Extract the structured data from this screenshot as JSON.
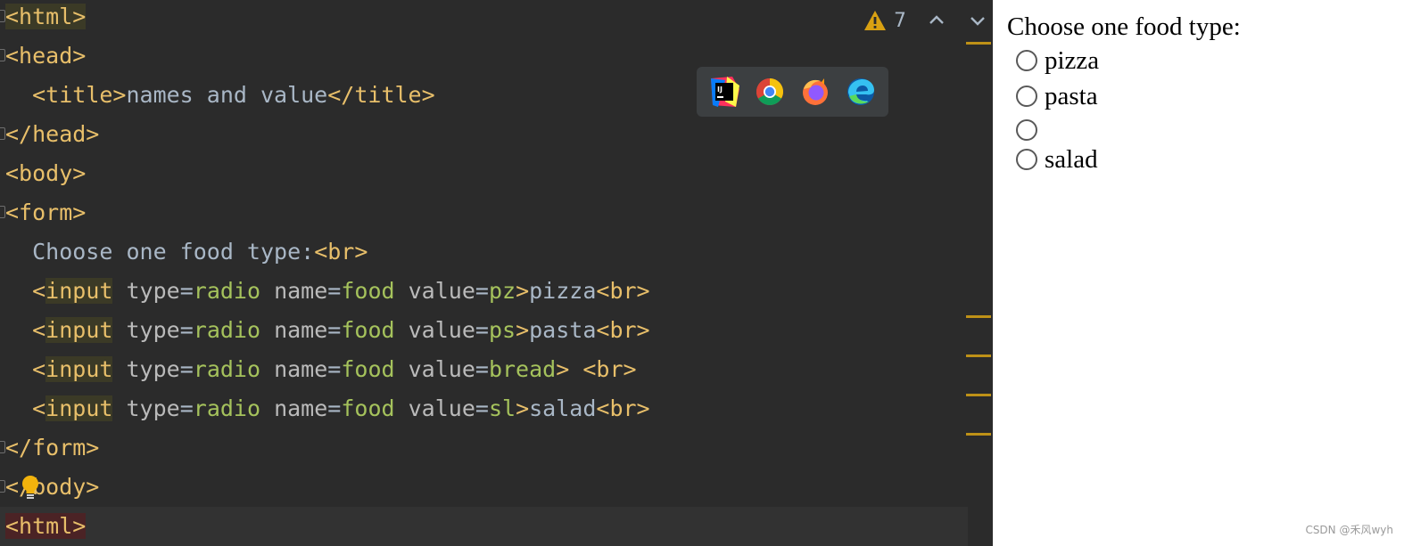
{
  "editor": {
    "lines": [
      {
        "parts": [
          {
            "c": "tag hl-olive",
            "t": "<html>"
          }
        ]
      },
      {
        "parts": [
          {
            "c": "tag",
            "t": "<head>"
          }
        ]
      },
      {
        "parts": [
          {
            "c": "txt",
            "t": "  "
          },
          {
            "c": "tag",
            "t": "<title>"
          },
          {
            "c": "txt",
            "t": "names and value"
          },
          {
            "c": "tag",
            "t": "</title>"
          }
        ]
      },
      {
        "parts": [
          {
            "c": "tag",
            "t": "</head>"
          }
        ]
      },
      {
        "parts": [
          {
            "c": "tag",
            "t": "<body>"
          }
        ]
      },
      {
        "parts": [
          {
            "c": "tag",
            "t": "<form>"
          }
        ]
      },
      {
        "parts": [
          {
            "c": "txt",
            "t": "  Choose one food type:"
          },
          {
            "c": "tag",
            "t": "<br>"
          }
        ]
      },
      {
        "parts": [
          {
            "c": "txt",
            "t": "  "
          },
          {
            "c": "tag",
            "t": "<"
          },
          {
            "c": "tag hl-olive",
            "t": "input"
          },
          {
            "c": "attr",
            "t": " type"
          },
          {
            "c": "txt",
            "t": "="
          },
          {
            "c": "val",
            "t": "radio"
          },
          {
            "c": "attr",
            "t": " name"
          },
          {
            "c": "txt",
            "t": "="
          },
          {
            "c": "val",
            "t": "food"
          },
          {
            "c": "attr",
            "t": " value"
          },
          {
            "c": "txt",
            "t": "="
          },
          {
            "c": "val",
            "t": "pz"
          },
          {
            "c": "tag",
            "t": ">"
          },
          {
            "c": "txt",
            "t": "pizza"
          },
          {
            "c": "tag",
            "t": "<br>"
          }
        ]
      },
      {
        "parts": [
          {
            "c": "txt",
            "t": "  "
          },
          {
            "c": "tag",
            "t": "<"
          },
          {
            "c": "tag hl-olive",
            "t": "input"
          },
          {
            "c": "attr",
            "t": " type"
          },
          {
            "c": "txt",
            "t": "="
          },
          {
            "c": "val",
            "t": "radio"
          },
          {
            "c": "attr",
            "t": " name"
          },
          {
            "c": "txt",
            "t": "="
          },
          {
            "c": "val",
            "t": "food"
          },
          {
            "c": "attr",
            "t": " value"
          },
          {
            "c": "txt",
            "t": "="
          },
          {
            "c": "val",
            "t": "ps"
          },
          {
            "c": "tag",
            "t": ">"
          },
          {
            "c": "txt",
            "t": "pasta"
          },
          {
            "c": "tag",
            "t": "<br>"
          }
        ]
      },
      {
        "parts": [
          {
            "c": "txt",
            "t": "  "
          },
          {
            "c": "tag",
            "t": "<"
          },
          {
            "c": "tag hl-olive",
            "t": "input"
          },
          {
            "c": "attr",
            "t": " type"
          },
          {
            "c": "txt",
            "t": "="
          },
          {
            "c": "val",
            "t": "radio"
          },
          {
            "c": "attr",
            "t": " name"
          },
          {
            "c": "txt",
            "t": "="
          },
          {
            "c": "val",
            "t": "food"
          },
          {
            "c": "attr",
            "t": " value"
          },
          {
            "c": "txt",
            "t": "="
          },
          {
            "c": "val",
            "t": "bread"
          },
          {
            "c": "tag",
            "t": ">"
          },
          {
            "c": "txt",
            "t": " "
          },
          {
            "c": "tag",
            "t": "<br>"
          }
        ]
      },
      {
        "parts": [
          {
            "c": "txt",
            "t": "  "
          },
          {
            "c": "tag",
            "t": "<"
          },
          {
            "c": "tag hl-olive",
            "t": "input"
          },
          {
            "c": "attr",
            "t": " type"
          },
          {
            "c": "txt",
            "t": "="
          },
          {
            "c": "val",
            "t": "radio"
          },
          {
            "c": "attr",
            "t": " name"
          },
          {
            "c": "txt",
            "t": "="
          },
          {
            "c": "val",
            "t": "food"
          },
          {
            "c": "attr",
            "t": " value"
          },
          {
            "c": "txt",
            "t": "="
          },
          {
            "c": "val",
            "t": "sl"
          },
          {
            "c": "tag",
            "t": ">"
          },
          {
            "c": "txt",
            "t": "salad"
          },
          {
            "c": "tag",
            "t": "<br>"
          }
        ]
      },
      {
        "parts": [
          {
            "c": "tag",
            "t": "</form>"
          }
        ]
      },
      {
        "parts": [
          {
            "c": "tag",
            "t": "</body>"
          }
        ]
      },
      {
        "parts": [
          {
            "c": "tag hl-red",
            "t": "<html>"
          }
        ],
        "current": true
      }
    ],
    "folded_lines": [
      0,
      1,
      3,
      5,
      11,
      12
    ],
    "warning_count": "7",
    "icons": {
      "warning": "warning-triangle-icon",
      "previous": "chevron-up-icon",
      "next": "chevron-down-icon",
      "intention": "lightbulb-icon"
    },
    "browsers": [
      "intellij-idea-icon",
      "chrome-icon",
      "firefox-icon",
      "edge-icon"
    ],
    "colors": {
      "background": "#2b2b2b",
      "tag": "#e8bf6a",
      "attribute": "#bababa",
      "value": "#a5c25c",
      "text": "#a9b7c6",
      "warning": "#be9117"
    }
  },
  "preview": {
    "prompt": "Choose one food type:",
    "options": [
      {
        "label": "pizza",
        "checked": false
      },
      {
        "label": "pasta",
        "checked": false
      },
      {
        "label": "",
        "checked": false
      },
      {
        "label": "salad",
        "checked": false
      }
    ],
    "watermark": "CSDN @禾风wyh"
  }
}
